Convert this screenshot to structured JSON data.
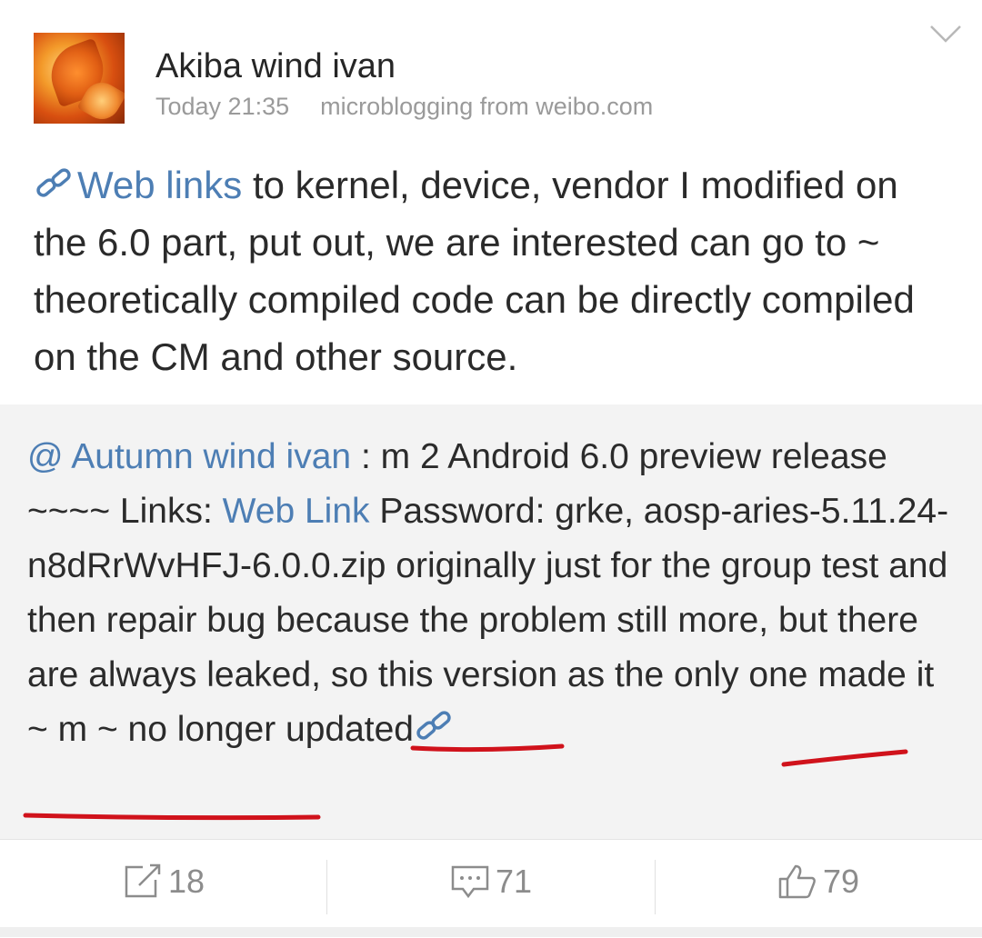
{
  "post": {
    "author": "Akiba wind ivan",
    "time": "Today 21:35",
    "source": "microblogging from weibo.com",
    "text_link": "Web links",
    "text_body": " to kernel, device, vendor I modified on the 6.0 part, put out, we are interested can go to ~ theoretically compiled code can be directly compiled on the CM and other source."
  },
  "repost": {
    "mention": "@ Autumn wind ivan",
    "text_1": " : m 2 Android 6.0 preview release ~~~~ Links: ",
    "link": "Web Link",
    "text_2": " Password: grke, aosp-aries-5.11.24-n8dRrWvHFJ-6.0.0.zip originally just for the group test and then repair bug because the problem still more, but there are always leaked, so this version as the ",
    "underlined_1": "only one",
    "text_3": " made it ~ m ",
    "underlined_2": "~ no longer updated"
  },
  "actions": {
    "repost_count": "18",
    "comment_count": "71",
    "like_count": "79"
  },
  "colors": {
    "link": "#4d7eb4",
    "underline_annotation": "#d0121b",
    "repost_background": "#f3f3f3"
  },
  "icons": [
    "chevron-down-icon",
    "link-icon",
    "repost-icon",
    "comment-icon",
    "like-icon"
  ]
}
